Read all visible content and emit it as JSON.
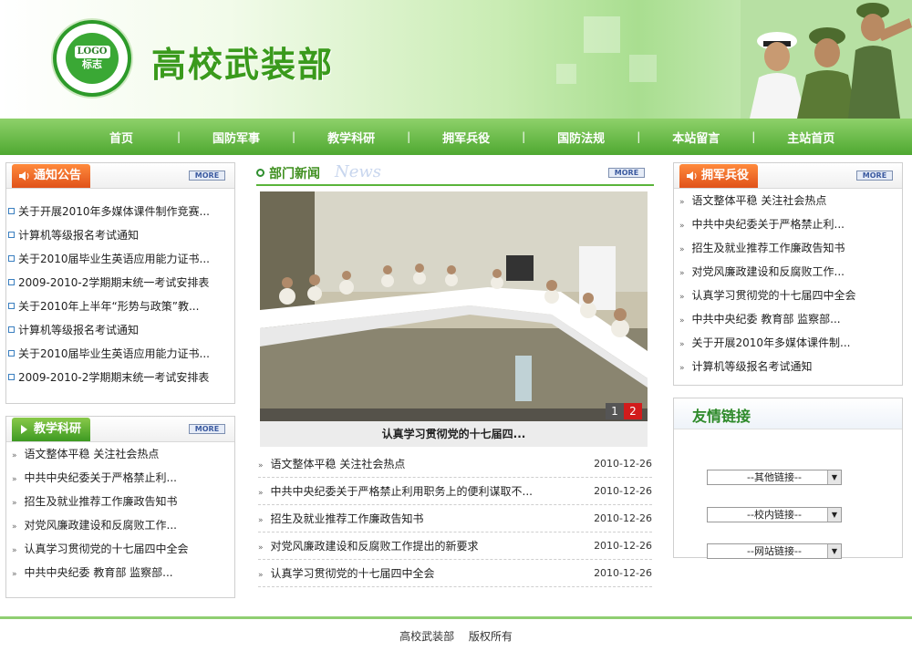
{
  "header": {
    "site_title": "高校武装部",
    "logo": {
      "top_text": "LOGO",
      "bottom_text": "标志",
      "ring_text": "Visual SiteBuilder"
    }
  },
  "nav": {
    "items": [
      "首页",
      "国防军事",
      "教学科研",
      "拥军兵役",
      "国防法规",
      "本站留言",
      "主站首页"
    ],
    "separator": "|"
  },
  "notice": {
    "title": "通知公告",
    "more": "MORE",
    "items": [
      "关于开展2010年多媒体课件制作竞赛...",
      "计算机等级报名考试通知",
      "关于2010届毕业生英语应用能力证书...",
      "2009-2010-2学期期末统一考试安排表",
      "关于2010年上半年“形势与政策”教...",
      "计算机等级报名考试通知",
      "关于2010届毕业生英语应用能力证书...",
      "2009-2010-2学期期末统一考试安排表"
    ]
  },
  "teaching": {
    "title": "教学科研",
    "more": "MORE",
    "items": [
      "语文整体平稳 关注社会热点",
      "中共中央纪委关于严格禁止利...",
      "招生及就业推荐工作廉政告知书",
      "对党风廉政建设和反腐败工作...",
      "认真学习贯彻党的十七届四中全会",
      "中共中央纪委 教育部 监察部..."
    ]
  },
  "dept_news": {
    "title": "部门新闻",
    "subtitle": "News",
    "more": "MORE",
    "photo_caption": "认真学习贯彻党的十七届四...",
    "pager": [
      "1",
      "2"
    ],
    "items": [
      {
        "title": "语文整体平稳 关注社会热点",
        "date": "2010-12-26"
      },
      {
        "title": "中共中央纪委关于严格禁止利用职务上的便利谋取不...",
        "date": "2010-12-26"
      },
      {
        "title": "招生及就业推荐工作廉政告知书",
        "date": "2010-12-26"
      },
      {
        "title": "对党风廉政建设和反腐败工作提出的新要求",
        "date": "2010-12-26"
      },
      {
        "title": "认真学习贯彻党的十七届四中全会",
        "date": "2010-12-26"
      }
    ]
  },
  "support": {
    "title": "拥军兵役",
    "more": "MORE",
    "items": [
      "语文整体平稳 关注社会热点",
      "中共中央纪委关于严格禁止利...",
      "招生及就业推荐工作廉政告知书",
      "对党风廉政建设和反腐败工作...",
      "认真学习贯彻党的十七届四中全会",
      "中共中央纪委 教育部 监察部...",
      "关于开展2010年多媒体课件制...",
      "计算机等级报名考试通知"
    ]
  },
  "links": {
    "title": "友情链接",
    "selects": [
      "--其他链接--",
      "--校内链接--",
      "--网站链接--"
    ]
  },
  "footer": {
    "text": "高校武装部　 版权所有"
  },
  "colors": {
    "nav_green": "#5fb63d",
    "tab_orange": "#e9621f",
    "tab_green": "#4ea52a",
    "title_green": "#3a9a1c"
  }
}
